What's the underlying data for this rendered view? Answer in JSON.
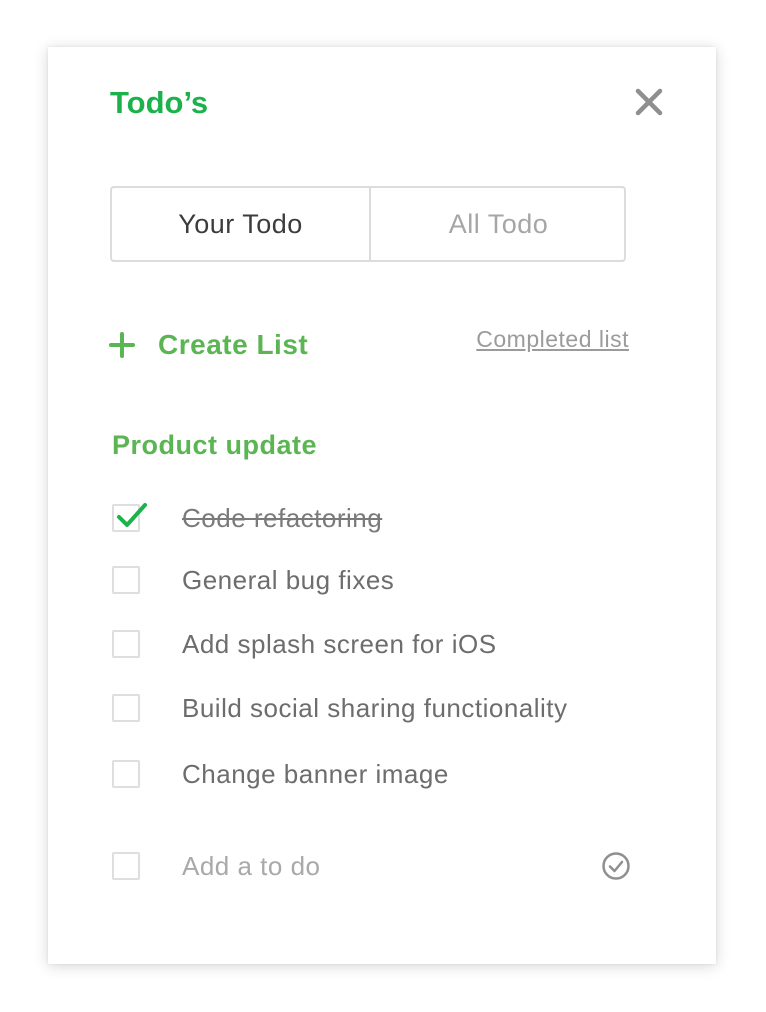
{
  "colors": {
    "accent": "#1bb24b",
    "accent_secondary": "#5ab552",
    "muted": "#9b9b9b",
    "icon_gray": "#8f8f8f"
  },
  "header": {
    "title": "Todo’s",
    "close_icon": "close-icon"
  },
  "tabs": [
    {
      "label": "Your Todo",
      "active": true
    },
    {
      "label": "All Todo",
      "active": false
    }
  ],
  "actions": {
    "create_list_label": "Create List",
    "create_list_icon": "plus-icon",
    "completed_list_label": "Completed list"
  },
  "list": {
    "title": "Product update",
    "items": [
      {
        "label": "Code refactoring",
        "checked": true
      },
      {
        "label": "General bug fixes",
        "checked": false
      },
      {
        "label": "Add splash screen for iOS",
        "checked": false
      },
      {
        "label": "Build social sharing functionality",
        "checked": false
      },
      {
        "label": "Change banner image",
        "checked": false
      }
    ],
    "add_placeholder": "Add a to do",
    "confirm_icon": "check-circle-icon"
  }
}
